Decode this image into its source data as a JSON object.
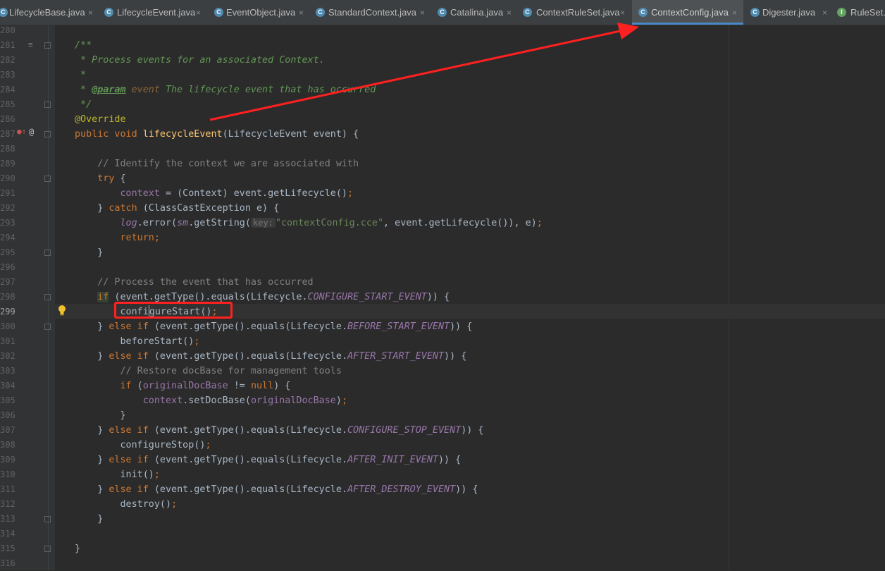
{
  "tabs": [
    {
      "label": "LifecycleBase.java",
      "icon": "class-icon",
      "active": false
    },
    {
      "label": "LifecycleEvent.java",
      "icon": "class-icon",
      "active": false
    },
    {
      "label": "EventObject.java",
      "icon": "class-icon",
      "active": false
    },
    {
      "label": "StandardContext.java",
      "icon": "class-icon",
      "active": false
    },
    {
      "label": "Catalina.java",
      "icon": "class-icon",
      "active": false
    },
    {
      "label": "ContextRuleSet.java",
      "icon": "class-icon",
      "active": false
    },
    {
      "label": "ContextConfig.java",
      "icon": "class-icon",
      "active": true
    },
    {
      "label": "Digester.java",
      "icon": "class-icon",
      "active": false
    },
    {
      "label": "RuleSet.j",
      "icon": "interface-icon",
      "active": false
    }
  ],
  "tab_close_glyph": "×",
  "line_numbers": [
    "280",
    "281",
    "282",
    "283",
    "284",
    "285",
    "286",
    "287",
    "288",
    "289",
    "290",
    "291",
    "292",
    "293",
    "294",
    "295",
    "296",
    "297",
    "298",
    "299",
    "300",
    "301",
    "302",
    "303",
    "304",
    "305",
    "306",
    "307",
    "308",
    "309",
    "310",
    "311",
    "312",
    "313",
    "314",
    "315",
    "316"
  ],
  "current_line": "299",
  "code": {
    "l281": "/**",
    "l282": " * Process events for an associated Context.",
    "l283": " *",
    "l284_star": " * ",
    "l284_tag": "@param",
    "l284_name": " event",
    "l284_rest": " The lifecycle event that has occurred",
    "l285": " */",
    "l286": "@Override",
    "l287_kw": "public void ",
    "l287_fn": "lifecycleEvent",
    "l287_rest": "(LifecycleEvent event) {",
    "l289": "    // Identify the context we are associated with",
    "l290_kw": "    try",
    "l290_rest": " {",
    "l291_ind": "        ",
    "l291_fld": "context",
    "l291_rest": " = (Context) event.getLifecycle()",
    "l291_semi": ";",
    "l292_a": "    } ",
    "l292_kw": "catch",
    "l292_b": " (ClassCastException e) {",
    "l293_ind": "        ",
    "l293_log": "log",
    "l293_a": ".error(",
    "l293_sm": "sm",
    "l293_b": ".getString(",
    "l293_hint": "key:",
    "l293_str": "\"contextConfig.cce\"",
    "l293_c": ", event.getLifecycle()), e)",
    "l293_semi": ";",
    "l294": "        return;",
    "l295": "    }",
    "l297": "    // Process the event that has occurred",
    "l298_ind": "    ",
    "l298_kw": "if",
    "l298_a": " (event.getType().equals(Lifecycle.",
    "l298_const": "CONFIGURE_START_EVENT",
    "l298_b": ")) {",
    "l299_ind": "        ",
    "l299_a": "confi",
    "l299_b": "gureStart()",
    "l299_semi": ";",
    "l300_a": "    } ",
    "l300_kw": "else if",
    "l300_b": " (event.getType().equals(Lifecycle.",
    "l300_const": "BEFORE_START_EVENT",
    "l300_c": ")) {",
    "l301": "        beforeStart()",
    "l301_semi": ";",
    "l302_const": "AFTER_START_EVENT",
    "l303": "        // Restore docBase for management tools",
    "l304_ind": "        ",
    "l304_kw": "if",
    "l304_a": " (",
    "l304_fld": "originalDocBase",
    "l304_b": " != ",
    "l304_null": "null",
    "l304_c": ") {",
    "l305_ind": "            ",
    "l305_fld": "context",
    "l305_a": ".setDocBase(",
    "l305_fld2": "originalDocBase",
    "l305_b": ")",
    "l305_semi": ";",
    "l306": "        }",
    "l307_const": "CONFIGURE_STOP_EVENT",
    "l308": "        configureStop()",
    "l309_const": "AFTER_INIT_EVENT",
    "l310": "        init()",
    "l311_const": "AFTER_DESTROY_EVENT",
    "l312": "        destroy()",
    "l313": "    }",
    "l315": "}"
  },
  "colors": {
    "editor_bg": "#2b2b2b",
    "keyword": "#cc7832",
    "comment": "#808080",
    "doc_comment": "#629755",
    "annotation": "#bbb529",
    "method_decl": "#ffc66d",
    "field": "#9876aa",
    "string": "#6a8759",
    "annotation_arrow": "#ff2020"
  }
}
